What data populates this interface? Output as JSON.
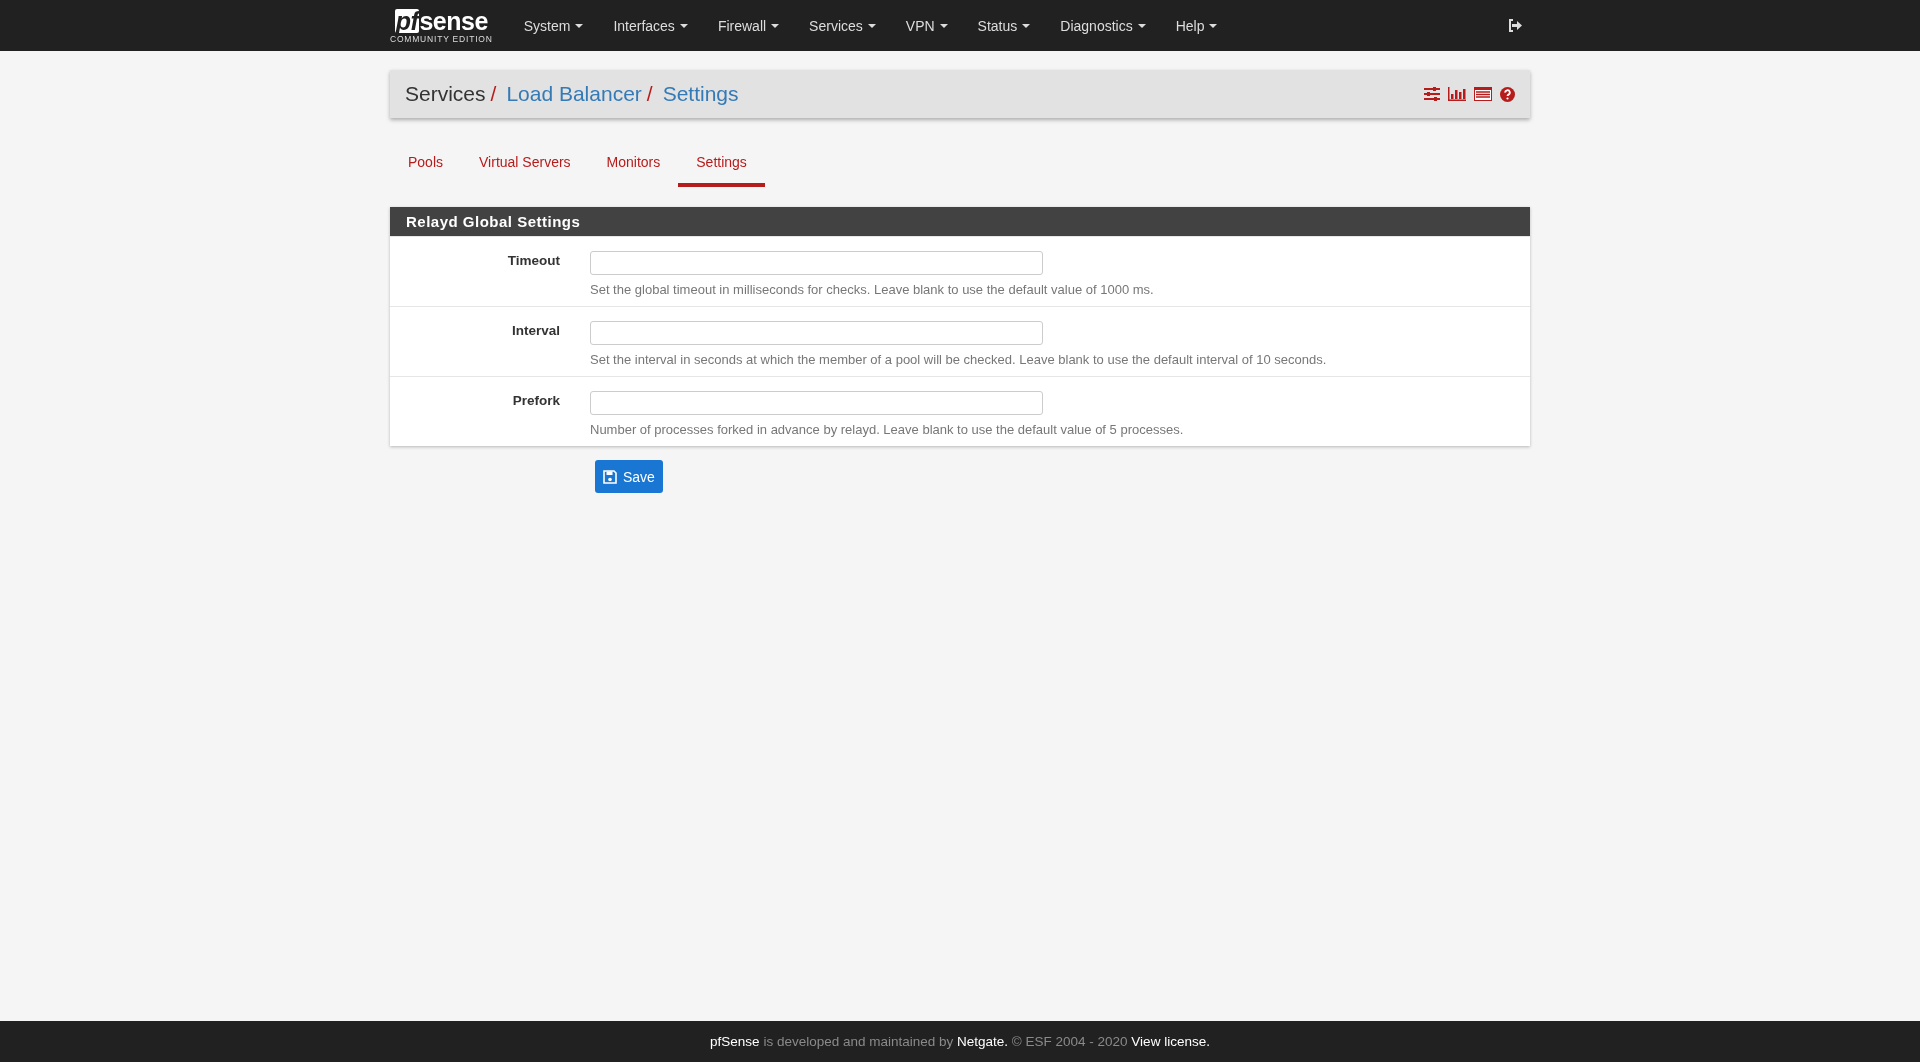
{
  "navbar": {
    "logo_mark": "pf",
    "logo_word": "sense",
    "logo_subtitle": "COMMUNITY EDITION",
    "menus": [
      {
        "label": "System"
      },
      {
        "label": "Interfaces"
      },
      {
        "label": "Firewall"
      },
      {
        "label": "Services"
      },
      {
        "label": "VPN"
      },
      {
        "label": "Status"
      },
      {
        "label": "Diagnostics"
      },
      {
        "label": "Help"
      }
    ]
  },
  "breadcrumb": {
    "separator": "/",
    "items": [
      {
        "label": "Services",
        "link": false
      },
      {
        "label": "Load Balancer",
        "link": true
      },
      {
        "label": "Settings",
        "link": true
      }
    ]
  },
  "tabs": [
    {
      "label": "Pools",
      "selected": false
    },
    {
      "label": "Virtual Servers",
      "selected": false
    },
    {
      "label": "Monitors",
      "selected": false
    },
    {
      "label": "Settings",
      "selected": true
    }
  ],
  "panel": {
    "title": "Relayd Global Settings",
    "fields": [
      {
        "label": "Timeout",
        "help": "Set the global timeout in milliseconds for checks. Leave blank to use the default value of 1000 ms."
      },
      {
        "label": "Interval",
        "help": "Set the interval in seconds at which the member of a pool will be checked. Leave blank to use the default interval of 10 seconds."
      },
      {
        "label": "Prefork",
        "help": "Number of processes forked in advance by relayd. Leave blank to use the default value of 5 processes."
      }
    ]
  },
  "save_button": "Save",
  "footer": [
    {
      "kind": "brand",
      "text": "pfSense"
    },
    {
      "kind": "text",
      "text": " is developed and maintained by "
    },
    {
      "kind": "link",
      "text": "Netgate."
    },
    {
      "kind": "text",
      "text": " © ESF 2004 - 2020 "
    },
    {
      "kind": "link",
      "text": "View license."
    }
  ]
}
